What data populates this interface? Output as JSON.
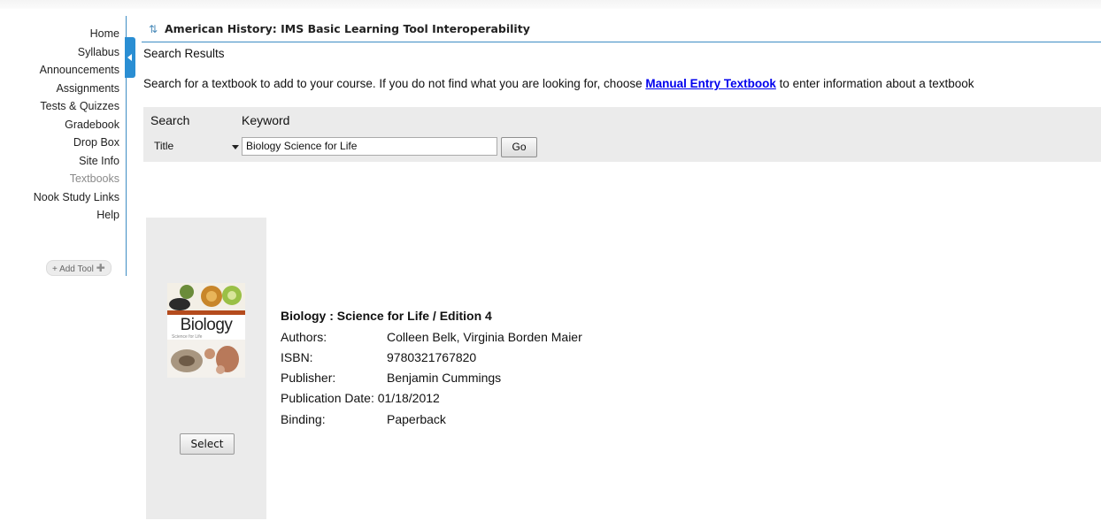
{
  "nav": {
    "items": [
      "Home",
      "Syllabus",
      "Announcements",
      "Assignments",
      "Tests & Quizzes",
      "Gradebook",
      "Drop Box",
      "Site Info",
      "Textbooks",
      "Nook Study Links",
      "Help"
    ],
    "current": "Textbooks",
    "add_tool": "+ Add Tool"
  },
  "header": {
    "title": "American History: IMS Basic Learning Tool Interoperability",
    "icon": "refresh-arrows-icon"
  },
  "page": {
    "results_label": "Search Results",
    "instructions_before": "Search for a textbook to add to your course. If you do not find what you are looking for, choose ",
    "instructions_link": "Manual Entry Textbook",
    "instructions_after": " to enter information about a textbook"
  },
  "search": {
    "search_label": "Search",
    "keyword_label": "Keyword",
    "field_value": "Title",
    "keyword_value": "Biology  Science for Life",
    "go_label": "Go"
  },
  "result": {
    "cover_word": "Biology",
    "cover_sub": "Science for Life",
    "title": "Biology : Science for Life / Edition 4",
    "fields": {
      "authors_label": "Authors:",
      "authors": "Colleen Belk, Virginia Borden Maier",
      "isbn_label": "ISBN:",
      "isbn": "9780321767820",
      "publisher_label": "Publisher:",
      "publisher": "Benjamin Cummings",
      "date_label": "Publication Date:",
      "date": "01/18/2012",
      "binding_label": "Binding:",
      "binding": "Paperback"
    },
    "select_label": "Select"
  },
  "colors": {
    "accent": "#2a8ed3",
    "link": "#0000ee",
    "panel": "#ebebeb",
    "cover_stripe": "#b44b1d"
  }
}
